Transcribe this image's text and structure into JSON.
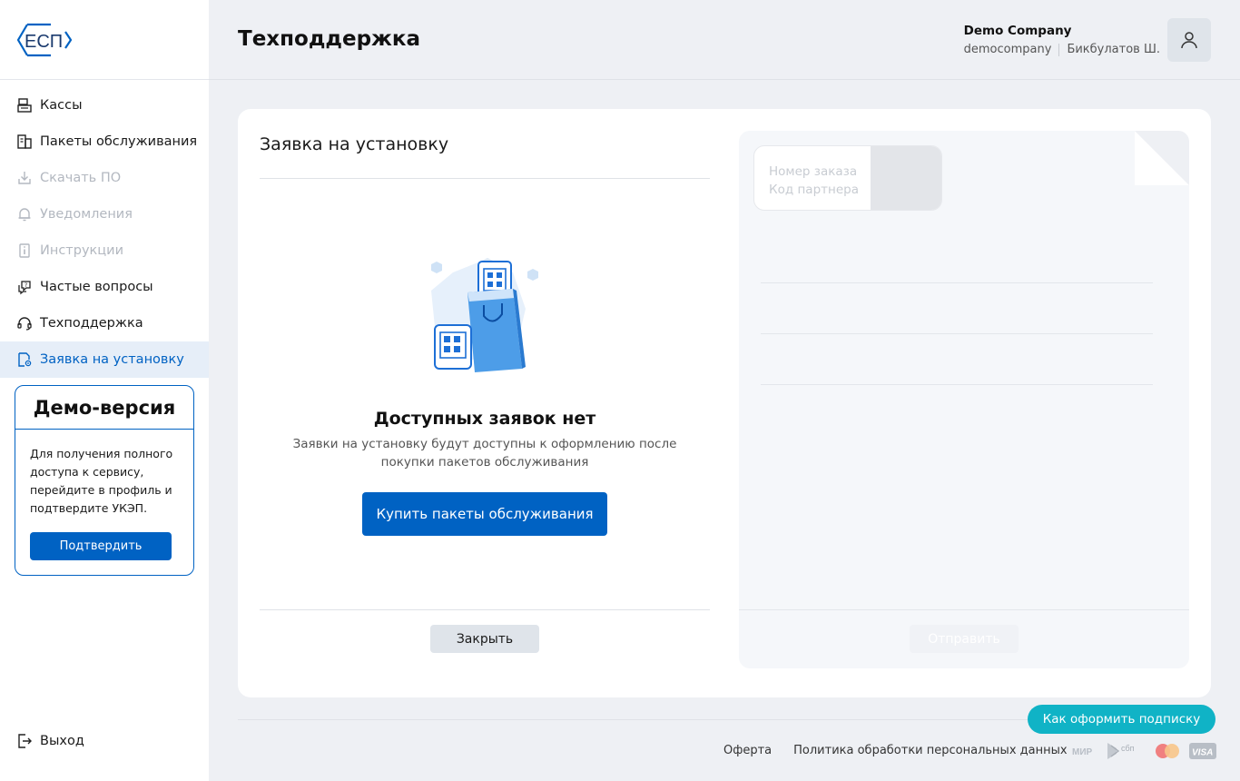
{
  "logo": {
    "text": "ЕСП"
  },
  "sidebar": {
    "items": [
      {
        "label": "Кассы",
        "icon": "cash-register-icon",
        "state": "normal"
      },
      {
        "label": "Пакеты обслуживания",
        "icon": "package-icon",
        "state": "normal"
      },
      {
        "label": "Скачать ПО",
        "icon": "download-icon",
        "state": "disabled"
      },
      {
        "label": "Уведомления",
        "icon": "bell-icon",
        "state": "disabled"
      },
      {
        "label": "Инструкции",
        "icon": "info-icon",
        "state": "disabled"
      },
      {
        "label": "Частые вопросы",
        "icon": "faq-icon",
        "state": "normal"
      },
      {
        "label": "Техподдержка",
        "icon": "headset-icon",
        "state": "normal"
      },
      {
        "label": "Заявка на установку",
        "icon": "document-gear-icon",
        "state": "active"
      }
    ],
    "demo": {
      "title": "Демо-версия",
      "text": "Для получения полного доступа к сервису, перейдите в профиль и подтвердите УКЭП.",
      "button": "Подтвердить"
    },
    "logout": "Выход"
  },
  "header": {
    "title": "Техподдержка",
    "company_name": "Demo Company",
    "company_login": "democompany",
    "user_name": "Бикбулатов Ш."
  },
  "modal": {
    "title": "Заявка на установку",
    "empty_title": "Доступных заявок нет",
    "empty_desc": "Заявки на установку будут доступны к оформлению после покупки пакетов обслуживания",
    "buy_button": "Купить пакеты обслуживания",
    "close_button": "Закрыть"
  },
  "right_panel": {
    "field_labels": [
      "Номер заказа",
      "Код партнера"
    ],
    "send_button": "Отправить"
  },
  "footer": {
    "help_button": "Как оформить подписку",
    "links": [
      "Оферта",
      "Политика обработки персональных данных"
    ],
    "payment_labels": [
      "МИР",
      "сбп",
      "VISA"
    ]
  },
  "colors": {
    "primary": "#0062c3",
    "accent": "#10b3c6",
    "active_bg": "#e6eef8"
  }
}
